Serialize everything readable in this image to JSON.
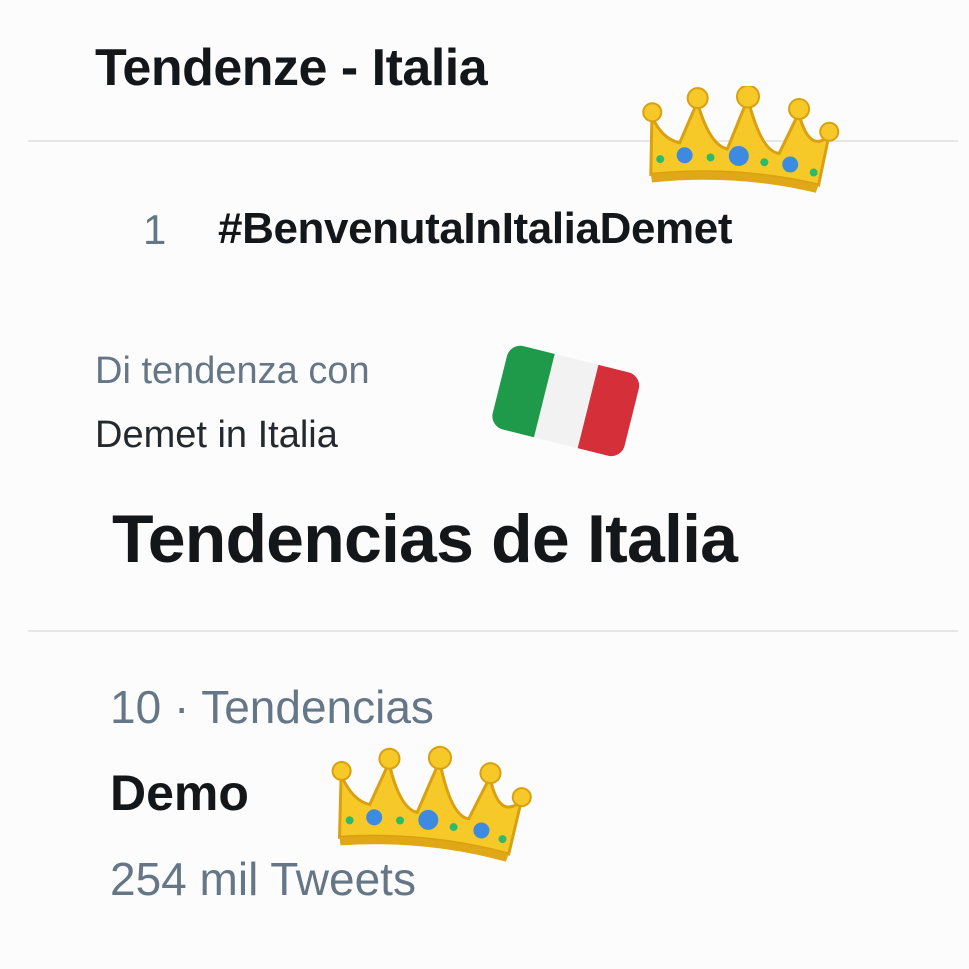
{
  "top_panel": {
    "title": "Tendenze - Italia",
    "trend": {
      "rank": "1",
      "hashtag": "#BenvenutaInItaliaDemet",
      "context_line1": "Di tendenza con",
      "context_line2": "Demet in Italia"
    }
  },
  "bottom_panel": {
    "title": "Tendencias de Italia",
    "trend": {
      "meta": "10 · Tendencias",
      "name": "Demo",
      "count": "254 mil Tweets"
    }
  },
  "decorations": {
    "crown_icon": "crown-emoji",
    "flag_icon": "italy-flag-emoji",
    "colors": {
      "flag_green": "#1f9a4a",
      "flag_white": "#f2f2f2",
      "flag_red": "#d5303a",
      "crown_gold": "#f7c928",
      "crown_jewel": "#3d8be0"
    }
  }
}
